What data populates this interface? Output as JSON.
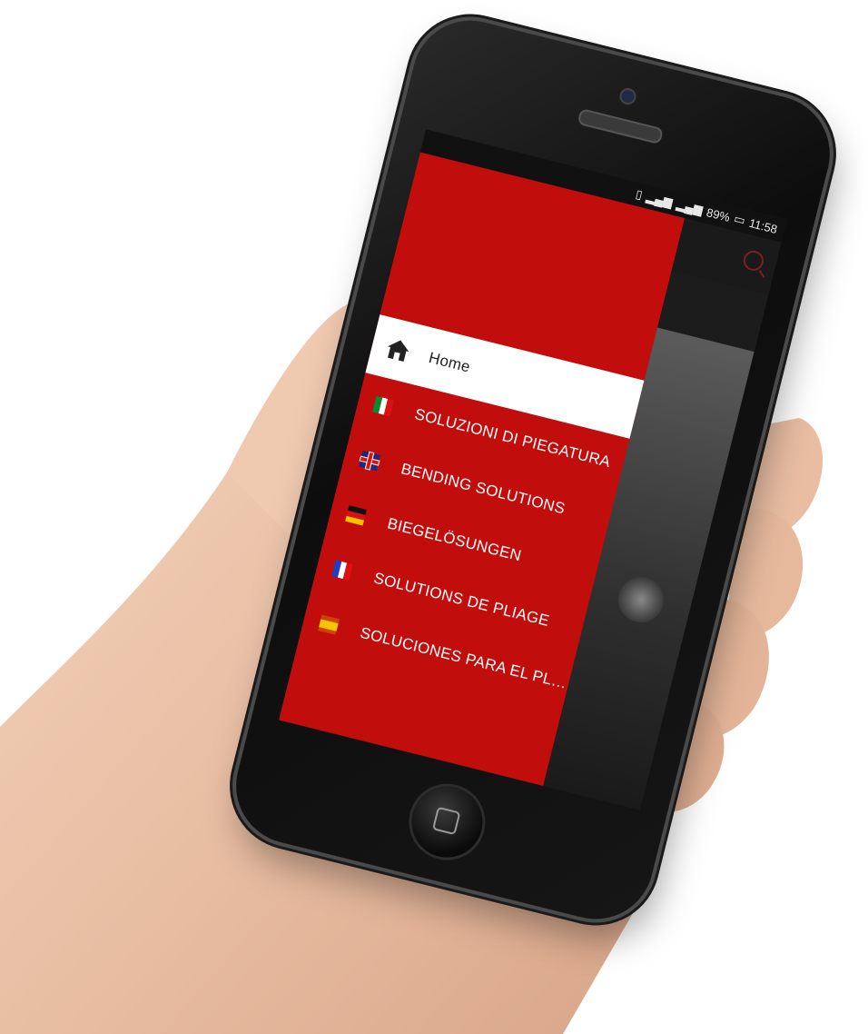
{
  "status_bar": {
    "icons": [
      "vibrate-icon",
      "signal-icon",
      "signal-4g-icon",
      "battery-icon"
    ],
    "battery": "89%",
    "time": "11:58"
  },
  "app_bar": {
    "search_icon": "search-icon"
  },
  "drawer": {
    "items": [
      {
        "icon": "home-icon",
        "label": "Home",
        "active": true
      },
      {
        "icon": "flag-italy-icon",
        "label": "SOLUZIONI DI PIEGATURA",
        "active": false
      },
      {
        "icon": "flag-uk-icon",
        "label": "BENDING SOLUTIONS",
        "active": false
      },
      {
        "icon": "flag-germany-icon",
        "label": "BIEGELÖSUNGEN",
        "active": false
      },
      {
        "icon": "flag-france-icon",
        "label": "SOLUTIONS DE PLIAGE",
        "active": false
      },
      {
        "icon": "flag-spain-icon",
        "label": "SOLUCIONES PARA EL PLEGA...",
        "active": false
      }
    ]
  },
  "colors": {
    "drawer_red": "#c20d0d",
    "active_item_bg": "#ffffff",
    "accent_search": "#7b2020"
  }
}
